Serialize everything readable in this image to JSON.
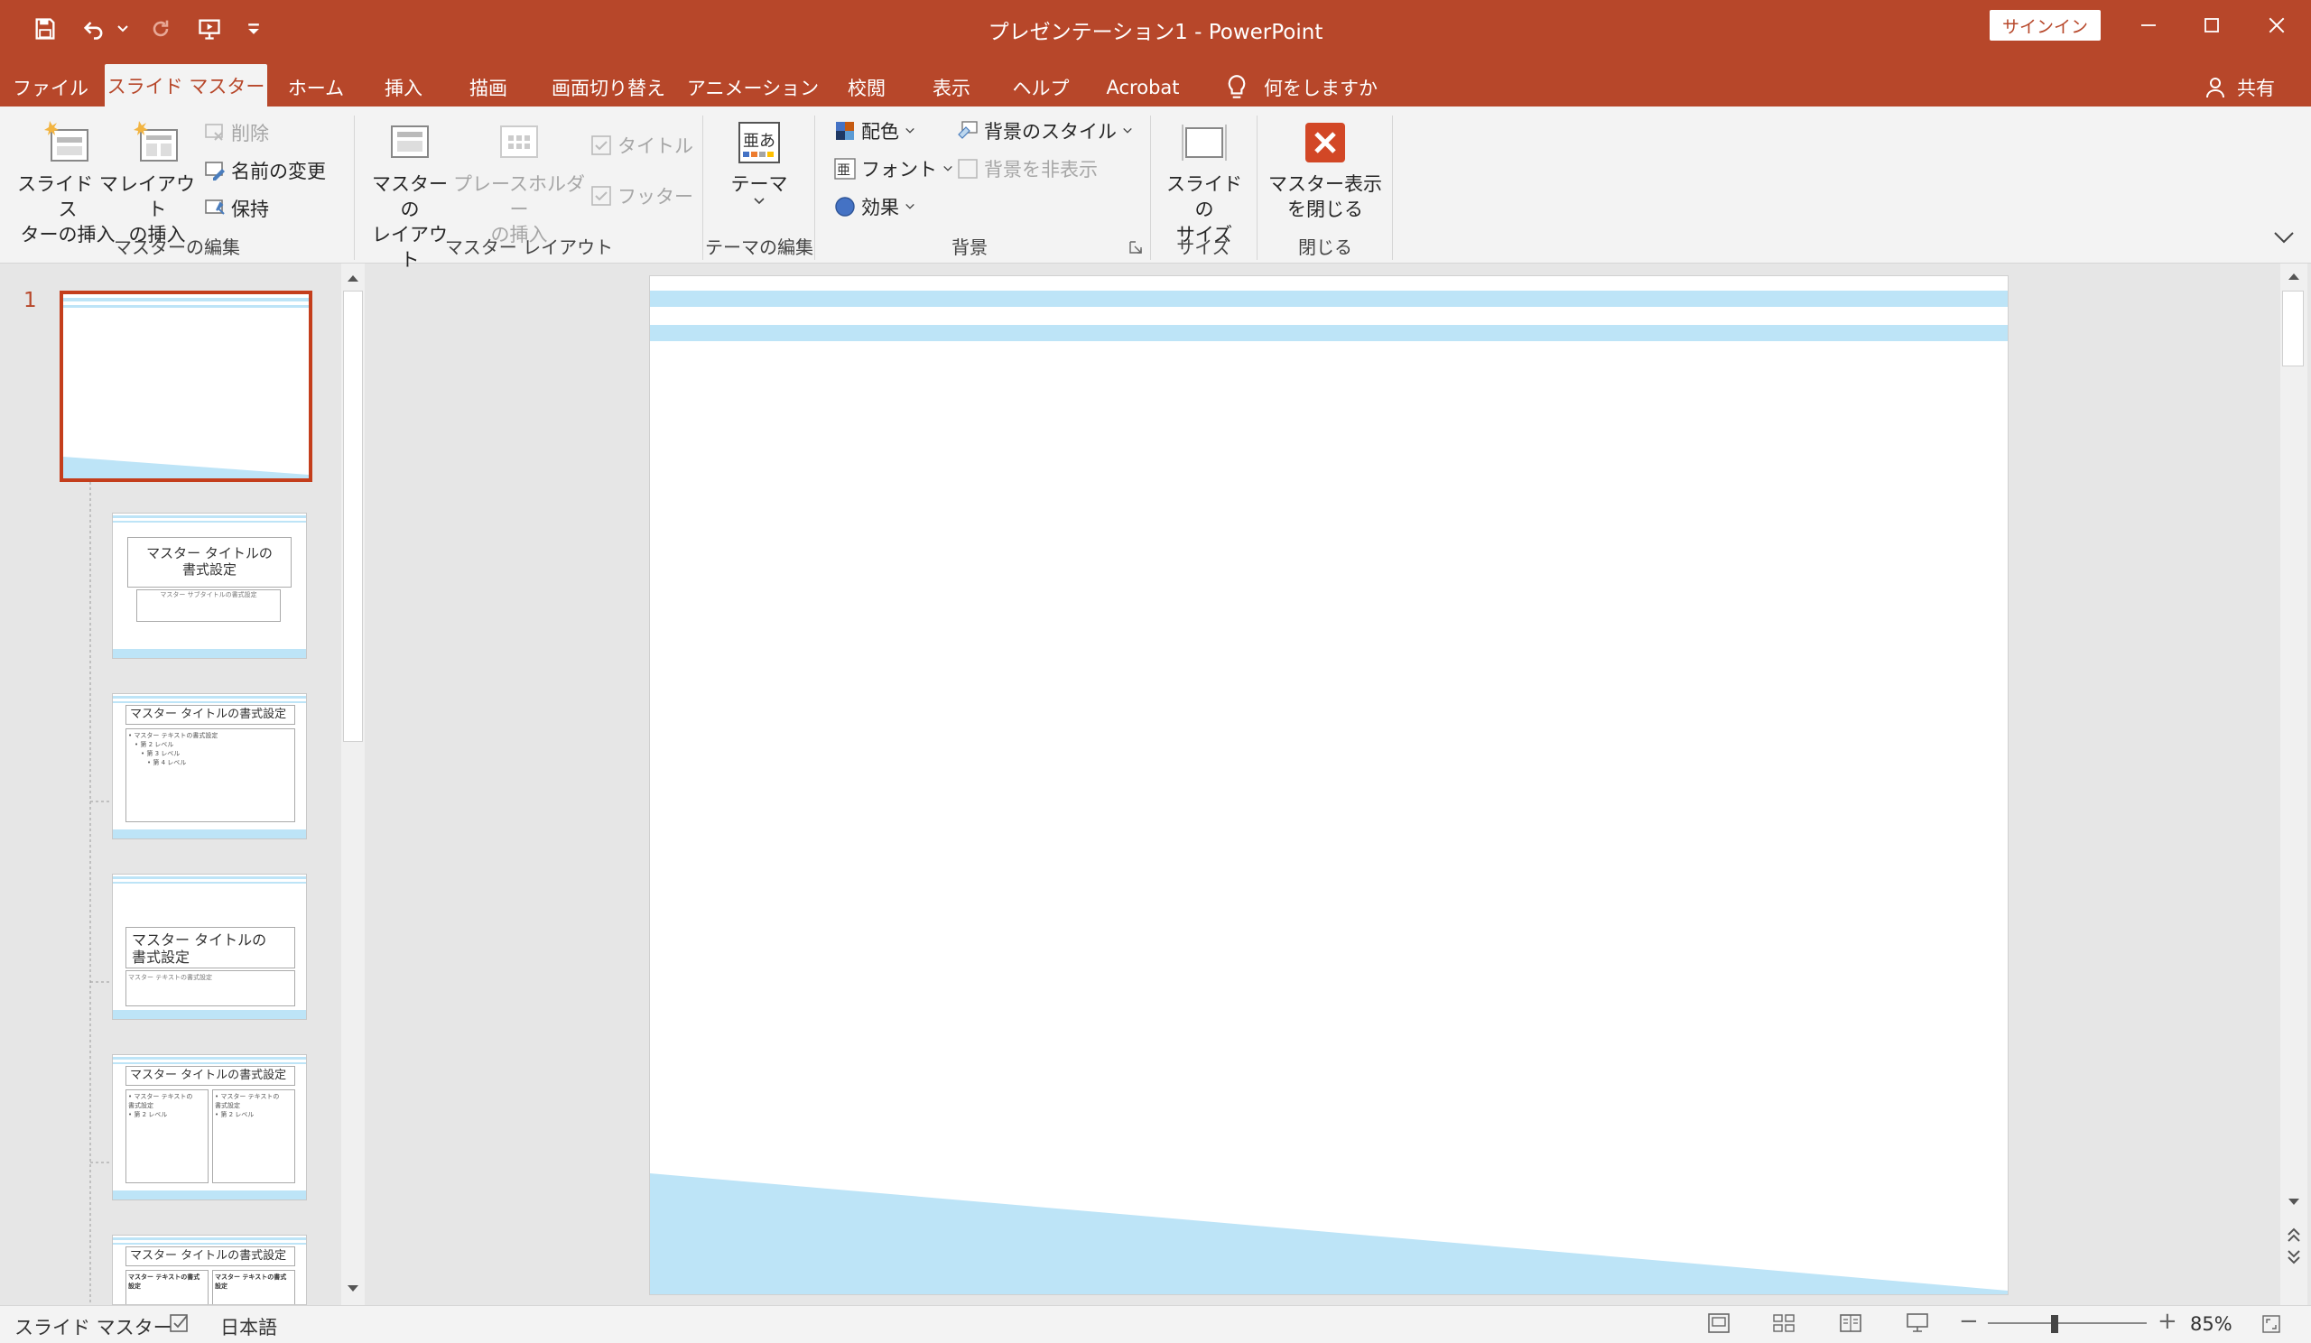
{
  "app": {
    "title": "プレゼンテーション1 - PowerPoint",
    "signin_label": "サインイン",
    "accent": "#b7472a"
  },
  "qat": {
    "icons": [
      "save-icon",
      "undo-icon",
      "redo-icon",
      "start-from-beginning-icon",
      "customize-icon"
    ]
  },
  "tabs": [
    {
      "label": "ファイル"
    },
    {
      "label": "スライド マスター",
      "active": true
    },
    {
      "label": "ホーム"
    },
    {
      "label": "挿入"
    },
    {
      "label": "描画"
    },
    {
      "label": "画面切り替え"
    },
    {
      "label": "アニメーション"
    },
    {
      "label": "校閲"
    },
    {
      "label": "表示"
    },
    {
      "label": "ヘルプ"
    },
    {
      "label": "Acrobat"
    },
    {
      "label": "何をしますか"
    }
  ],
  "share_label": "共有",
  "ribbon": {
    "insert_slide_master": "スライド マス\nターの挿入",
    "insert_layout": "レイアウト\nの挿入",
    "delete": "削除",
    "rename": "名前の変更",
    "preserve": "保持",
    "master_layout": "マスターの\nレイアウト",
    "insert_placeholder": "プレースホルダー\nの挿入",
    "title_check": "タイトル",
    "footer_check": "フッター",
    "themes": "テーマ",
    "colors": "配色",
    "fonts": "フォント",
    "effects": "効果",
    "background_styles": "背景のスタイル",
    "hide_background": "背景を非表示",
    "slide_size": "スライドの\nサイズ",
    "close_master": "マスター表示\nを閉じる",
    "groups": {
      "edit_master": "マスターの編集",
      "master_layout": "マスター レイアウト",
      "edit_theme": "テーマの編集",
      "background": "背景",
      "size": "サイズ",
      "close": "閉じる"
    }
  },
  "thumbnails": {
    "master_number": "1",
    "layout1_title": "マスター タイトルの\n書式設定",
    "layout1_subtitle": "マスター サブタイトルの書式設定",
    "layout2_title": "マスター タイトルの書式設定",
    "layout2_body": "• マスター テキストの書式設定\n　• 第 2 レベル\n　　• 第 3 レベル\n　　　• 第 4 レベル",
    "layout3_title": "マスター タイトルの\n書式設定",
    "layout3_body": "マスター テキストの書式設定",
    "layout4_title": "マスター タイトルの書式設定",
    "layout4_body": "• マスター テキストの\n書式設定\n• 第 2 レベル",
    "layout5_title": "マスター タイトルの書式設定",
    "layout5_head": "マスター テキストの書式設定"
  },
  "status": {
    "view": "スライド マスター",
    "language": "日本語",
    "zoom": "85%"
  },
  "colors": {
    "band": "#bde4f7",
    "active_border": "#c43e1c"
  }
}
